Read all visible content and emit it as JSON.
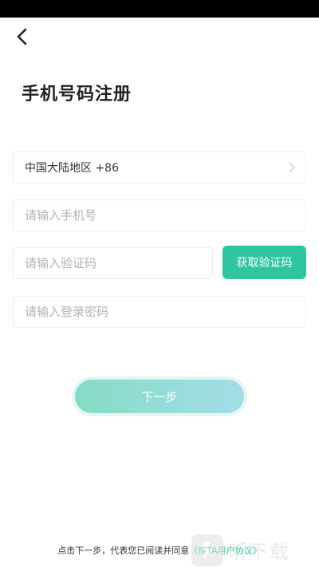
{
  "header": {
    "title": "手机号码注册"
  },
  "form": {
    "region_label": "中国大陆地区 +86",
    "phone_placeholder": "请输入手机号",
    "phone_value": "",
    "code_placeholder": "请输入验证码",
    "code_value": "",
    "password_placeholder": "请输入登录密码",
    "password_value": "",
    "get_code_label": "获取验证码",
    "next_label": "下一步"
  },
  "agreement": {
    "prefix": "点击下一步，代表您已阅读并同意",
    "link_text": "《撩TA用户协议》"
  },
  "watermark": {
    "text": "昕下载"
  },
  "colors": {
    "accent": "#2ec6a0",
    "next_gradient_start": "#86dcc6",
    "next_gradient_end": "#a3dde8",
    "status_bar": "#000000"
  },
  "icons": {
    "back": "chevron-left-icon",
    "region_arrow": "chevron-right-icon"
  }
}
